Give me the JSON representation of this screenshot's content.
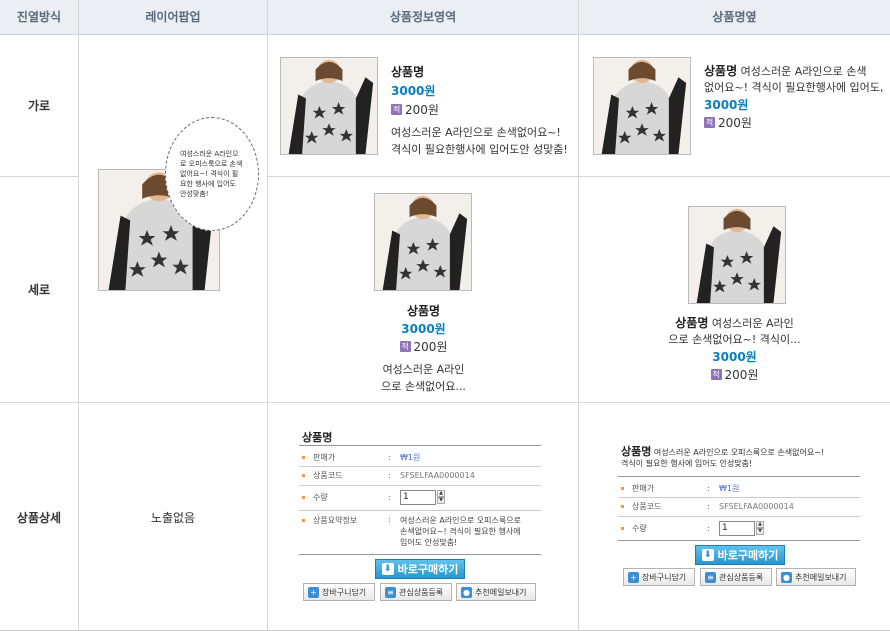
{
  "headers": {
    "col1": "진열방식",
    "col2": "레이어팝업",
    "col3": "상품정보영역",
    "col4": "상품명옆"
  },
  "rows": {
    "horizontal": "가로",
    "vertical": "세로",
    "detail": "상품상세"
  },
  "product": {
    "name": "상품명",
    "price": "3000원",
    "points_icon": "적",
    "points": "200원",
    "desc_full_1": "여성스러운 A라인으로 손색없어요~!",
    "desc_full_2": "격식이 필요한행사에 입어도안 성맞춤!",
    "name_side_line1": "여성스러운 A라인으로 손색",
    "name_side_line2": "없어요~! 격식이 필요한행사에 입어도,",
    "vert_desc_1": "여성스러운 A라인",
    "vert_desc_2": "으로 손색없어요...",
    "vert_side_line1": "여성스러운 A라인",
    "vert_side_line2": "으로 손색없어요~! 격식이..."
  },
  "bubble": {
    "text": "여성스러운 A라인으로 오피스룩으로 손색없어요~! 격식이 필요한 행사에 입어도 안성맞춤!"
  },
  "detail": {
    "no_exposure": "노출없음",
    "title": "상품명",
    "side_title_desc": "여성스러운 A라인으로 오피스룩으로 손색없어요~!",
    "side_title_desc2": "격식이 필요한 행사에 입어도 안성맞춤!",
    "seller_label": "판매가",
    "seller_value": "₩1원",
    "code_label": "상품코드",
    "code_value": "SFSELFAA0000014",
    "qty_label": "수량",
    "qty_value": "1",
    "summary_label": "상품요약정보",
    "summary_1": "여성스러운 A라인으로 오피스룩으로",
    "summary_2": "손색없어요~! 격식이 필요한 행사에",
    "summary_3": "입어도 안성맞춤!",
    "buy_label": "바로구매하기",
    "cart_label": "장바구니담기",
    "wish_label": "관심상품등록",
    "mail_label": "추천메일보내기"
  },
  "colors": {
    "header_bg": "#ebeff4",
    "price": "#0a7fbf",
    "buy_button": "#2996cf",
    "points_badge": "#8f72b8"
  }
}
